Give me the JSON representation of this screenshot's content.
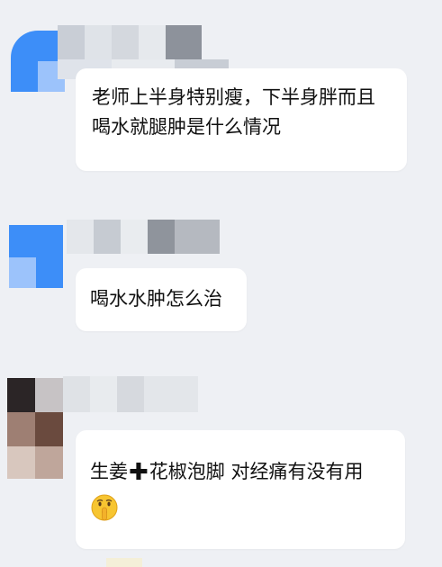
{
  "messages": [
    {
      "avatar": "blurred-avatar-1",
      "sender": "",
      "lines": [
        "老师上半身特别瘦，下半身胖而且",
        "喝水就腿肿是什么情况"
      ]
    },
    {
      "avatar": "blurred-avatar-2",
      "sender": "",
      "lines": [
        "喝水水肿怎么治"
      ]
    },
    {
      "avatar": "blurred-avatar-3",
      "sender": "",
      "text_before_plus": "生姜",
      "plus": "✚",
      "text_after_plus": "花椒泡脚  对经痛有没有用",
      "emoji": "shushing-face-emoji"
    }
  ],
  "colors": {
    "background": "#eef0f4",
    "bubble": "#ffffff",
    "text": "#111111",
    "avatar_blue": "#3d8ef8"
  }
}
